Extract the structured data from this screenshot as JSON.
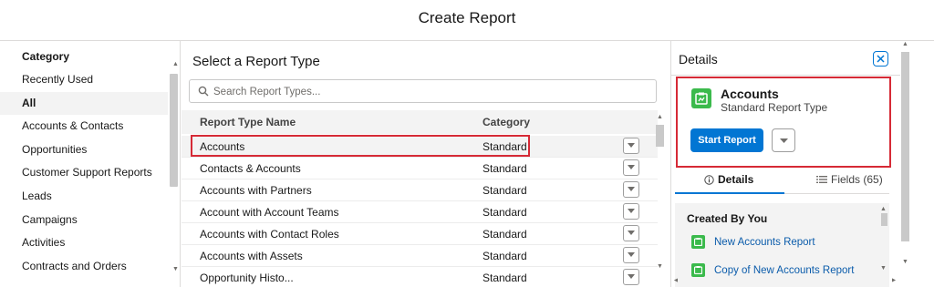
{
  "page": {
    "title": "Create Report"
  },
  "sidebar": {
    "heading": "Category",
    "items": [
      {
        "label": "Recently Used",
        "active": false
      },
      {
        "label": "All",
        "active": true
      },
      {
        "label": "Accounts & Contacts",
        "active": false
      },
      {
        "label": "Opportunities",
        "active": false
      },
      {
        "label": "Customer Support Reports",
        "active": false
      },
      {
        "label": "Leads",
        "active": false
      },
      {
        "label": "Campaigns",
        "active": false
      },
      {
        "label": "Activities",
        "active": false
      },
      {
        "label": "Contracts and Orders",
        "active": false
      }
    ]
  },
  "main": {
    "heading": "Select a Report Type",
    "search": {
      "placeholder": "Search Report Types...",
      "value": ""
    },
    "columns": {
      "name": "Report Type Name",
      "category": "Category"
    },
    "rows": [
      {
        "name": "Accounts",
        "category": "Standard"
      },
      {
        "name": "Contacts & Accounts",
        "category": "Standard"
      },
      {
        "name": "Accounts with Partners",
        "category": "Standard"
      },
      {
        "name": "Account with Account Teams",
        "category": "Standard"
      },
      {
        "name": "Accounts with Contact Roles",
        "category": "Standard"
      },
      {
        "name": "Accounts with Assets",
        "category": "Standard"
      },
      {
        "name": "Opportunity Histo...",
        "category": "Standard"
      }
    ]
  },
  "details": {
    "title": "Details",
    "report_type_name": "Accounts",
    "report_type_subtitle": "Standard Report Type",
    "start_label": "Start Report",
    "tabs": {
      "details": "Details",
      "fields": "Fields (65)"
    },
    "created_heading": "Created By You",
    "created_items": [
      "New Accounts Report",
      "Copy of New Accounts Report"
    ]
  },
  "colors": {
    "accent": "#0176d3",
    "highlight": "#d62a36",
    "report_icon": "#3bba4c",
    "link": "#0b5cab"
  }
}
